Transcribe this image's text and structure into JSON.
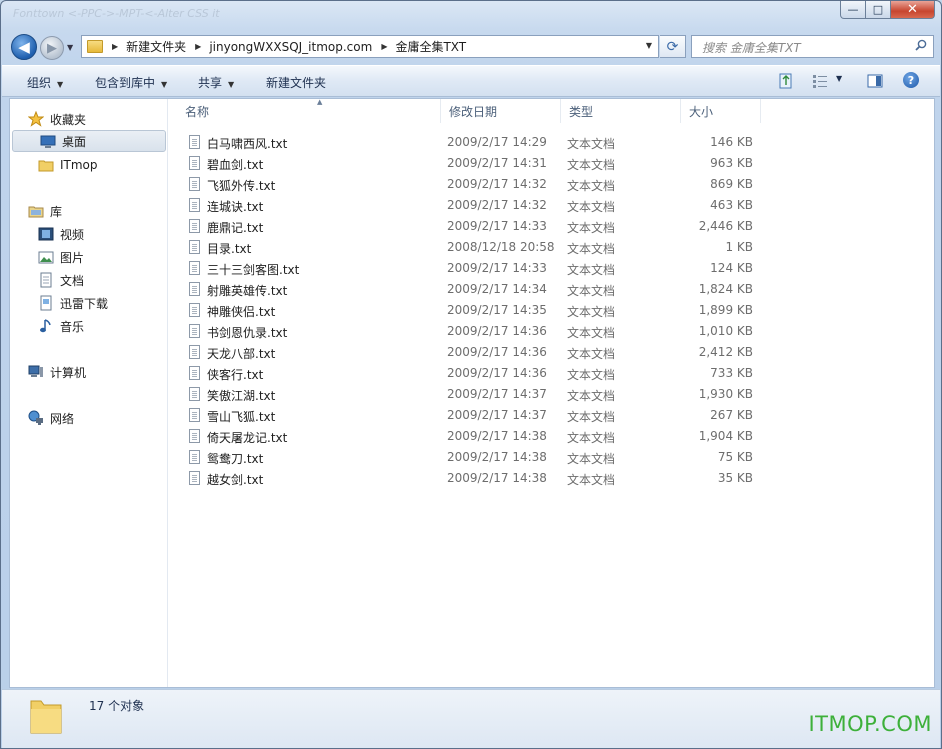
{
  "window": {
    "title": "Fonttown <-PPC->-MPT-<-Alter CSS it",
    "caption_min": "—",
    "caption_max": "□",
    "caption_close": "✕"
  },
  "navbar": {
    "back_glyph": "◀",
    "fwd_glyph": "▶",
    "history_glyph": "▼",
    "breadcrumbs": [
      "新建文件夹",
      "jinyongWXXSQJ_itmop.com",
      "金庸全集TXT"
    ],
    "sep_glyph": "▶",
    "dropdown_glyph": "▼",
    "refresh_glyph": "⟳",
    "search_placeholder": "搜索 金庸全集TXT"
  },
  "toolbar": {
    "organize": "组织",
    "include_library": "包含到库中",
    "share": "共享",
    "new_folder": "新建文件夹",
    "caret": "▼",
    "help_glyph": "?"
  },
  "navpane": {
    "favorites": "收藏夹",
    "desktop": "桌面",
    "itmop": "ITmop",
    "libraries": "库",
    "videos": "视频",
    "pictures": "图片",
    "documents": "文档",
    "thunder": "迅雷下载",
    "music": "音乐",
    "computer": "计算机",
    "network": "网络"
  },
  "columns": {
    "name": "名称",
    "modified": "修改日期",
    "type": "类型",
    "size": "大小",
    "sort_glyph": "▲"
  },
  "files": [
    {
      "name": "白马啸西风.txt",
      "date": "2009/2/17 14:29",
      "type": "文本文档",
      "size": "146 KB"
    },
    {
      "name": "碧血剑.txt",
      "date": "2009/2/17 14:31",
      "type": "文本文档",
      "size": "963 KB"
    },
    {
      "name": "飞狐外传.txt",
      "date": "2009/2/17 14:32",
      "type": "文本文档",
      "size": "869 KB"
    },
    {
      "name": "连城诀.txt",
      "date": "2009/2/17 14:32",
      "type": "文本文档",
      "size": "463 KB"
    },
    {
      "name": "鹿鼎记.txt",
      "date": "2009/2/17 14:33",
      "type": "文本文档",
      "size": "2,446 KB"
    },
    {
      "name": "目录.txt",
      "date": "2008/12/18 20:58",
      "type": "文本文档",
      "size": "1 KB"
    },
    {
      "name": "三十三剑客图.txt",
      "date": "2009/2/17 14:33",
      "type": "文本文档",
      "size": "124 KB"
    },
    {
      "name": "射雕英雄传.txt",
      "date": "2009/2/17 14:34",
      "type": "文本文档",
      "size": "1,824 KB"
    },
    {
      "name": "神雕侠侣.txt",
      "date": "2009/2/17 14:35",
      "type": "文本文档",
      "size": "1,899 KB"
    },
    {
      "name": "书剑恩仇录.txt",
      "date": "2009/2/17 14:36",
      "type": "文本文档",
      "size": "1,010 KB"
    },
    {
      "name": "天龙八部.txt",
      "date": "2009/2/17 14:36",
      "type": "文本文档",
      "size": "2,412 KB"
    },
    {
      "name": "侠客行.txt",
      "date": "2009/2/17 14:36",
      "type": "文本文档",
      "size": "733 KB"
    },
    {
      "name": "笑傲江湖.txt",
      "date": "2009/2/17 14:37",
      "type": "文本文档",
      "size": "1,930 KB"
    },
    {
      "name": "雪山飞狐.txt",
      "date": "2009/2/17 14:37",
      "type": "文本文档",
      "size": "267 KB"
    },
    {
      "name": "倚天屠龙记.txt",
      "date": "2009/2/17 14:38",
      "type": "文本文档",
      "size": "1,904 KB"
    },
    {
      "name": "鸳鸯刀.txt",
      "date": "2009/2/17 14:38",
      "type": "文本文档",
      "size": "75 KB"
    },
    {
      "name": "越女剑.txt",
      "date": "2009/2/17 14:38",
      "type": "文本文档",
      "size": "35 KB"
    }
  ],
  "details": {
    "count": "17 个对象"
  },
  "watermark": "ITMOP.COM"
}
